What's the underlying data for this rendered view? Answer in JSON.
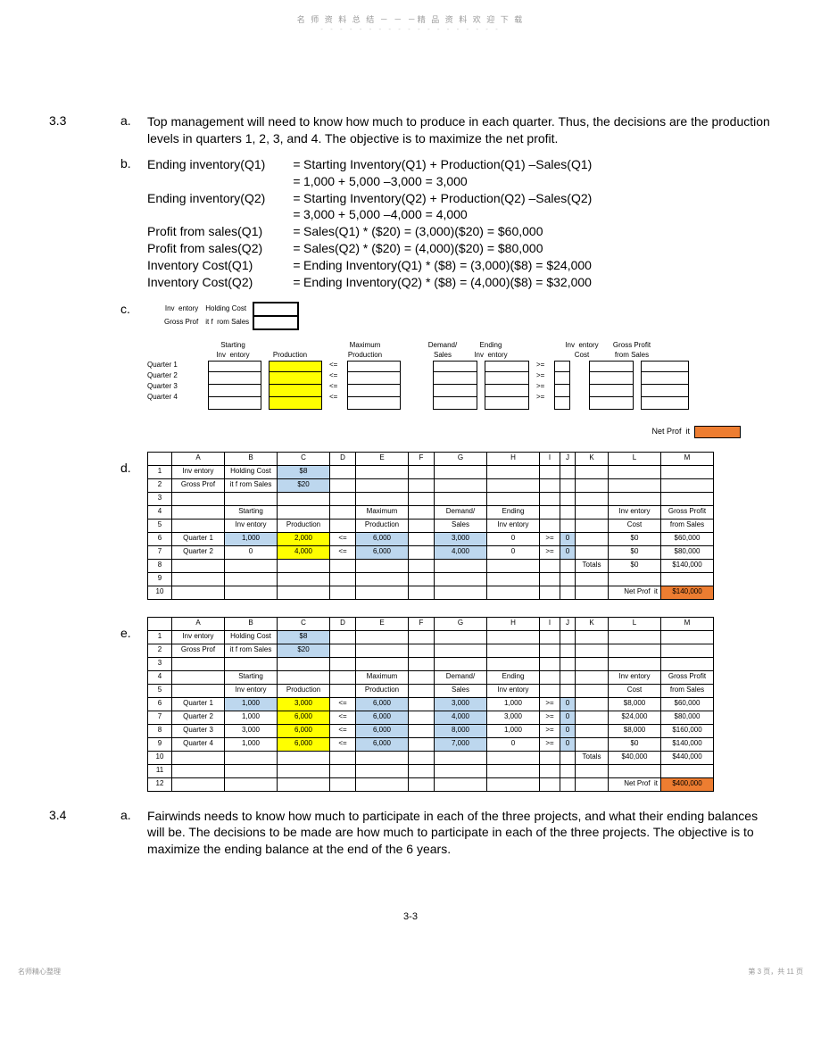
{
  "header": "名 师 资 料 总 结 － － －精 品 资 料 欢 迎 下 载",
  "p33": {
    "a": "Top management will need to know how much to produce in each quarter. Thus, the decisions are the production levels in quarters 1, 2, 3, and 4. The objective is to maximize the net profit.",
    "b": {
      "r1l": "Ending inventory(Q1)",
      "r1r": "Starting Inventory(Q1) + Production(Q1) –Sales(Q1)",
      "r1b": "1,000 + 5,000 –3,000 = 3,000",
      "r2l": "Ending inventory(Q2)",
      "r2r": "Starting Inventory(Q2) + Production(Q2) –Sales(Q2)",
      "r2b": "3,000 + 5,000 –4,000 = 4,000",
      "r3l": "Profit from sales(Q1)",
      "r3r": "Sales(Q1) * ($20) = (3,000)($20) = $60,000",
      "r4l": "Profit from sales(Q2)",
      "r4r": "Sales(Q2) * ($20) = (4,000)($20) = $80,000",
      "r5l": "Inventory Cost(Q1)",
      "r5r": "Ending Inventory(Q1) * ($8) = (3,000)($8) = $24,000",
      "r6l": "Inventory Cost(Q2)",
      "r6r": "Ending Inventory(Q2) * ($8) = (4,000)($8) = $32,000"
    },
    "c": {
      "lab1a": "Inv",
      "lab1b": "entory",
      "lab1c": "Holding Cost",
      "lab2a": "Gross Prof",
      "lab2b": "it f",
      "lab2c": "rom Sales",
      "h1a": "Starting",
      "h1b": "Inv",
      "h1c": "entory",
      "h2": "Production",
      "h3a": "Maximum",
      "h3b": "Production",
      "h4a": "Demand/",
      "h4b": "Sales",
      "h5a": "Ending",
      "h5b": "Inv",
      "h5c": "entory",
      "h6a": "Inv",
      "h6b": "entory",
      "h6c": "Cost",
      "h7a": "Gross Profit",
      "h7b": "from Sales",
      "q1": "Quarter 1",
      "q2": "Quarter 2",
      "q3": "Quarter 3",
      "q4": "Quarter 4",
      "le": "<=",
      "ge": ">=",
      "np": "Net Prof",
      "np2": "it"
    },
    "d": {
      "cols": [
        "A",
        "B",
        "C",
        "D",
        "E",
        "F",
        "G",
        "H",
        "I",
        "J",
        "K",
        "L",
        "M"
      ],
      "r1": [
        "Inv   entory",
        "Holding Cost",
        "$8"
      ],
      "r2": [
        "Gross Prof",
        "it f   rom Sales",
        "$20"
      ],
      "r4": [
        "Starting",
        "",
        "Maximum",
        "Demand/",
        "Ending",
        "Inv   entory",
        "Gross Profit"
      ],
      "r5": [
        "Inv   entory",
        "Production",
        "",
        "Production",
        "",
        "Sales",
        "Inv   entory",
        "",
        "Cost",
        "from Sales"
      ],
      "r6": [
        "Quarter 1",
        "1,000",
        "2,000",
        "<=",
        "6,000",
        "",
        "3,000",
        "0",
        ">=",
        "0",
        "",
        "$0",
        "$60,000"
      ],
      "r7": [
        "Quarter 2",
        "0",
        "4,000",
        "<=",
        "6,000",
        "",
        "4,000",
        "0",
        ">=",
        "0",
        "",
        "$0",
        "$80,000"
      ],
      "r8tot": "Totals",
      "r8a": "$0",
      "r8b": "$140,000",
      "r10np": "Net Prof",
      "r10np2": "it",
      "r10v": "$140,000"
    },
    "e": {
      "cols": [
        "A",
        "B",
        "C",
        "D",
        "E",
        "F",
        "G",
        "H",
        "I",
        "J",
        "K",
        "L",
        "M"
      ],
      "r1": [
        "Inv   entory",
        "Holding Cost",
        "$8"
      ],
      "r2": [
        "Gross Prof",
        "it f   rom Sales",
        "$20"
      ],
      "r4": [
        "Starting",
        "",
        "Maximum",
        "Demand/",
        "Ending",
        "Inv   entory",
        "Gross Profit"
      ],
      "r5": [
        "Inv   entory",
        "Production",
        "",
        "Production",
        "",
        "Sales",
        "Inv   entory",
        "",
        "Cost",
        "from Sales"
      ],
      "r6": [
        "Quarter 1",
        "1,000",
        "3,000",
        "<=",
        "6,000",
        "",
        "3,000",
        "1,000",
        ">=",
        "0",
        "",
        "$8,000",
        "$60,000"
      ],
      "r7": [
        "Quarter 2",
        "1,000",
        "6,000",
        "<=",
        "6,000",
        "",
        "4,000",
        "3,000",
        ">=",
        "0",
        "",
        "$24,000",
        "$80,000"
      ],
      "r8": [
        "Quarter 3",
        "3,000",
        "6,000",
        "<=",
        "6,000",
        "",
        "8,000",
        "1,000",
        ">=",
        "0",
        "",
        "$8,000",
        "$160,000"
      ],
      "r9": [
        "Quarter 4",
        "1,000",
        "6,000",
        "<=",
        "6,000",
        "",
        "7,000",
        "0",
        ">=",
        "0",
        "",
        "$0",
        "$140,000"
      ],
      "r10tot": "Totals",
      "r10a": "$40,000",
      "r10b": "$440,000",
      "r12np": "Net Prof",
      "r12np2": "it",
      "r12v": "$400,000"
    }
  },
  "p34": {
    "a": "Fairwinds needs to know how much to participate in each of the three projects, and what their ending balances will be. The decisions to be made are how much to participate in each of the three projects. The objective is to maximize the ending balance at the end of the 6 years."
  },
  "pagenum": "3-3",
  "footer_l": "名师精心整理",
  "footer_r": "第 3 页，共 11 页"
}
